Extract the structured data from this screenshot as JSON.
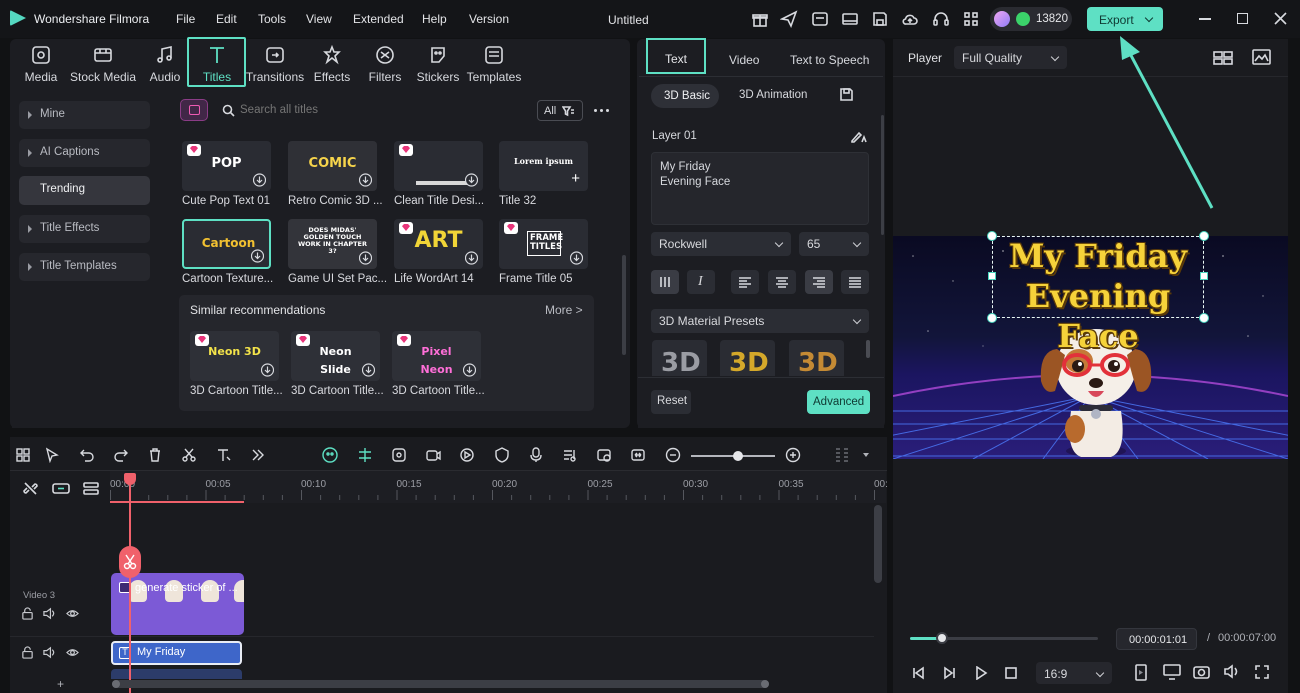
{
  "app": {
    "name": "Wondershare Filmora",
    "doc_title": "Untitled",
    "credits": "13820",
    "export_label": "Export"
  },
  "menu": [
    "File",
    "Edit",
    "Tools",
    "View",
    "Extended",
    "Help",
    "Version"
  ],
  "media_tabs": [
    {
      "label": "Media",
      "icon": "media-icon"
    },
    {
      "label": "Stock Media",
      "icon": "stock-media-icon"
    },
    {
      "label": "Audio",
      "icon": "audio-icon"
    },
    {
      "label": "Titles",
      "icon": "titles-icon"
    },
    {
      "label": "Transitions",
      "icon": "transitions-icon"
    },
    {
      "label": "Effects",
      "icon": "effects-icon"
    },
    {
      "label": "Filters",
      "icon": "filters-icon"
    },
    {
      "label": "Stickers",
      "icon": "stickers-icon"
    },
    {
      "label": "Templates",
      "icon": "templates-icon"
    }
  ],
  "sidebar": [
    "Mine",
    "AI Captions",
    "Trending",
    "Title Effects",
    "Title Templates"
  ],
  "search": {
    "placeholder": "Search all titles",
    "filter": "All"
  },
  "titles": [
    {
      "label": "Cute Pop Text 01",
      "preview": "POP"
    },
    {
      "label": "Retro Comic 3D ...",
      "preview": "COMIC"
    },
    {
      "label": "Clean Title Desi...",
      "preview": ""
    },
    {
      "label": "Title 32",
      "preview": "Lorem ipsum"
    },
    {
      "label": "Cartoon Texture...",
      "preview": "Cartoon"
    },
    {
      "label": "Game UI Set Pac...",
      "preview": "DOES MIDAS' GOLDEN TOUCH WORK IN CHAPTER 3?"
    },
    {
      "label": "Life WordArt 14",
      "preview": "ART"
    },
    {
      "label": "Frame Title 05",
      "preview": "FRAME TITLES"
    }
  ],
  "similar": {
    "heading": "Similar recommendations",
    "more": "More >",
    "items": [
      {
        "label": "3D Cartoon Title...",
        "preview": "Neon 3D"
      },
      {
        "label": "3D Cartoon Title...",
        "preview": "Neon Slide"
      },
      {
        "label": "3D Cartoon Title...",
        "preview": "Pixel Neon"
      }
    ]
  },
  "props": {
    "tabs": [
      "Text",
      "Video",
      "Text to Speech"
    ],
    "subtabs": [
      "3D Basic",
      "3D Animation"
    ],
    "layer": "Layer 01",
    "text_line1": "My Friday",
    "text_line2": "Evening Face",
    "font": "Rockwell",
    "size": "65",
    "preset_label": "3D Material Presets",
    "preset_tiles": [
      "3D",
      "3D",
      "3D"
    ],
    "reset": "Reset",
    "advanced": "Advanced"
  },
  "player": {
    "label": "Player",
    "quality": "Full Quality",
    "current": "00:00:01:01",
    "sep": "/",
    "total": "00:00:07:00",
    "ratio": "16:9",
    "progress": 0.17,
    "caption_line1": "My Friday",
    "caption_line2": "Evening Face"
  },
  "timeline": {
    "ruler": [
      "00:00",
      "00:05",
      "00:10",
      "00:15",
      "00:20",
      "00:25",
      "00:30",
      "00:35",
      "00:"
    ],
    "track_video": "Video 3",
    "clip_video": "generate sticker of ...",
    "clip_title": "My Friday",
    "zoom": 0.56
  },
  "colors": {
    "accent": "#5ee0c4",
    "playhead": "#f0616b",
    "clip_purple": "#7c5ad6",
    "clip_title": "#3e66c9"
  }
}
